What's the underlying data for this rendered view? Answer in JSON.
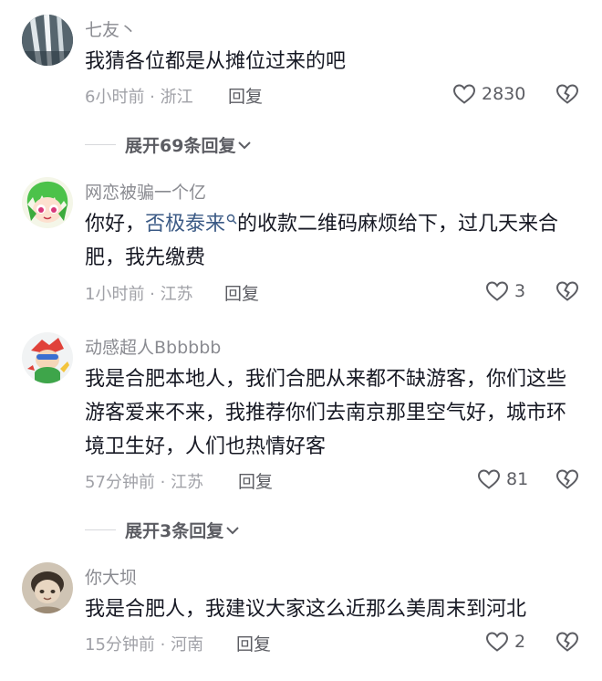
{
  "comments": [
    {
      "username": "七友丶",
      "content": "我猜各位都是从摊位过来的吧",
      "meta": "6小时前 · 浙江",
      "reply": "回复",
      "likes": "2830",
      "expand": "展开69条回复"
    },
    {
      "username": "网恋被骗一个亿",
      "content_before": "你好，",
      "hashtag": "否极泰来",
      "content_after": "的收款二维码麻烦给下，过几天来合肥，我先缴费",
      "meta": "1小时前 · 江苏",
      "reply": "回复",
      "likes": "3"
    },
    {
      "username": "动感超人Bbbbbb",
      "content": "我是合肥本地人，我们合肥从来都不缺游客，你们这些游客爱来不来，我推荐你们去南京那里空气好，城市环境卫生好，人们也热情好客",
      "meta": "57分钟前 · 江苏",
      "reply": "回复",
      "likes": "81",
      "expand": "展开3条回复"
    },
    {
      "username": "你大坝",
      "content": "我是合肥人，我建议大家这么近那么美周末到河北",
      "meta": "15分钟前 · 河南",
      "reply": "回复",
      "likes": "2"
    }
  ],
  "icons": {
    "like": "heart-outline-icon",
    "dislike": "broken-heart-icon",
    "expand": "chevron-down-icon",
    "search": "search-icon"
  },
  "colors": {
    "hashtag": "#3b5a85",
    "username": "#8a8b91",
    "meta": "#a0a1a7"
  }
}
